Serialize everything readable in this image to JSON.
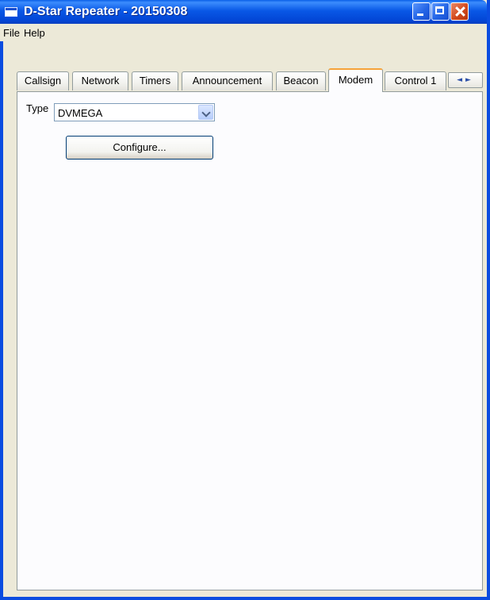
{
  "window": {
    "title": "D-Star Repeater - 20150308"
  },
  "menu": {
    "file": "File",
    "help": "Help"
  },
  "tabs": [
    {
      "label": "Callsign"
    },
    {
      "label": "Network"
    },
    {
      "label": "Timers"
    },
    {
      "label": "Announcement"
    },
    {
      "label": "Beacon"
    },
    {
      "label": "Modem",
      "active": true
    },
    {
      "label": "Control 1"
    }
  ],
  "tab_scroll": {
    "left": "◄",
    "right": "►"
  },
  "modem": {
    "type_label": "Type",
    "type_value": "DVMEGA",
    "configure_label": "Configure..."
  },
  "colors": {
    "titlebar": "#0a4ce0",
    "active_tab_accent": "#f6a33a",
    "panel": "#fcfcfe"
  }
}
